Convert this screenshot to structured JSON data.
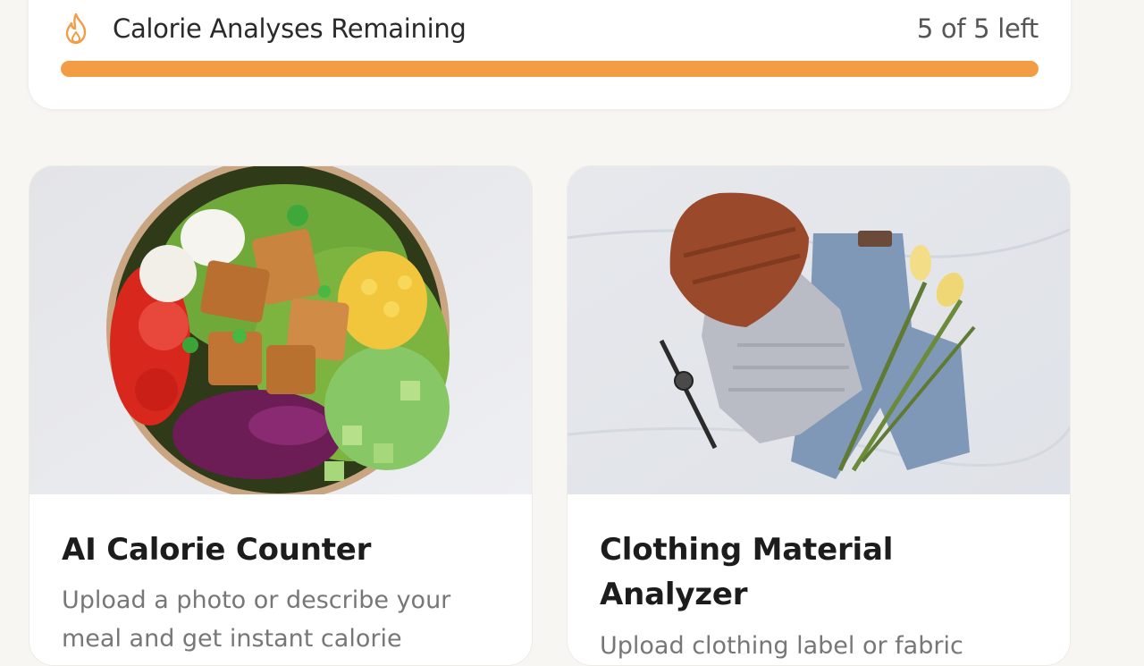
{
  "usage": {
    "icon": "flame-icon",
    "title": "Calorie Analyses Remaining",
    "count_text": "5 of 5 left",
    "remaining_fraction": 1.0,
    "accent_color": "#f29c44"
  },
  "tools": [
    {
      "image": "salad-bowl-photo",
      "title": "AI Calorie Counter",
      "description": "Upload a photo or describe your meal and get instant calorie"
    },
    {
      "image": "folded-clothes-photo",
      "title": "Clothing Material Analyzer",
      "description": "Upload clothing label or fabric"
    }
  ]
}
